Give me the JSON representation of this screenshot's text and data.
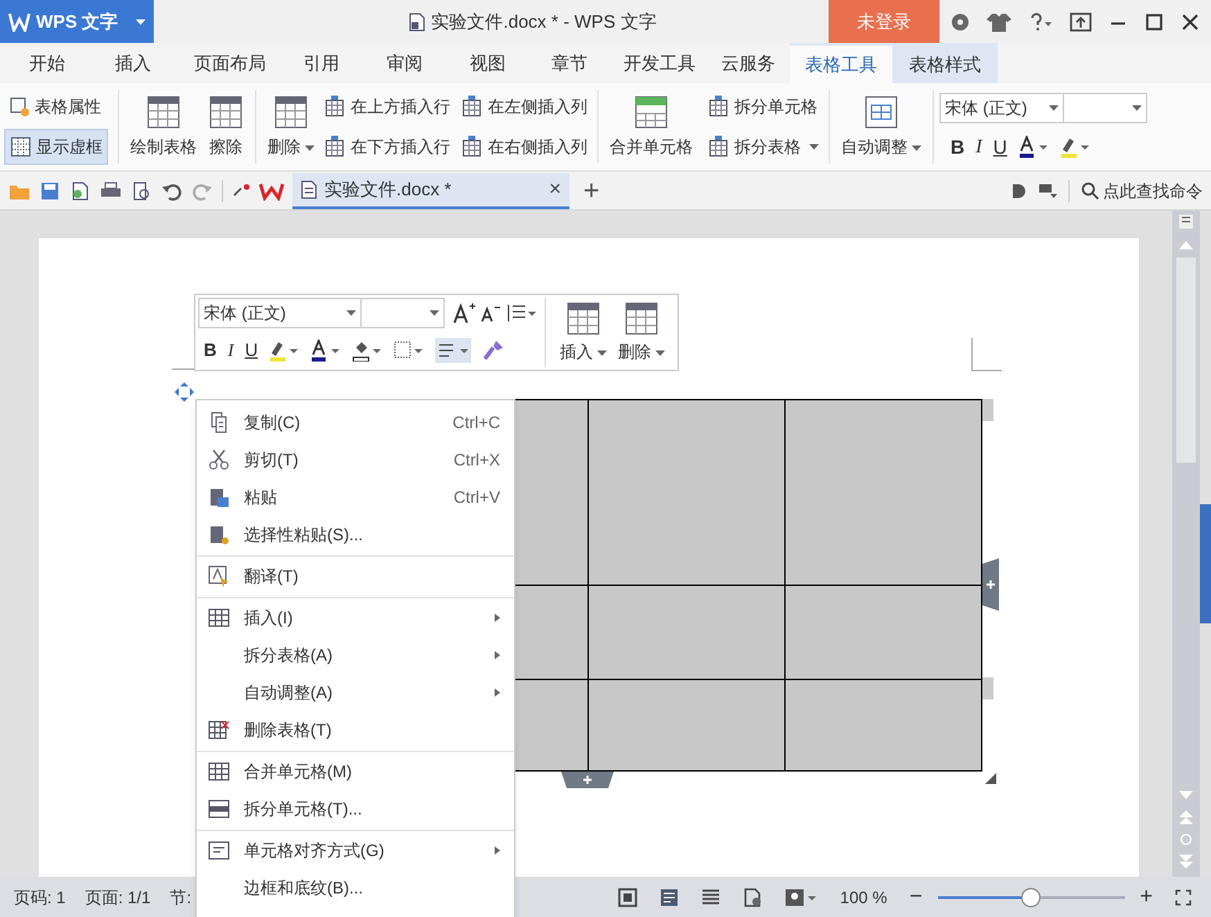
{
  "title_bar": {
    "app_button": "WPS 文字",
    "title": "实验文件.docx * - WPS 文字",
    "login_button": "未登录"
  },
  "menu_tabs": [
    {
      "label": "开始",
      "selected": false,
      "contextual": false
    },
    {
      "label": "插入",
      "selected": false,
      "contextual": false
    },
    {
      "label": "页面布局",
      "selected": false,
      "contextual": false
    },
    {
      "label": "引用",
      "selected": false,
      "contextual": false
    },
    {
      "label": "审阅",
      "selected": false,
      "contextual": false
    },
    {
      "label": "视图",
      "selected": false,
      "contextual": false
    },
    {
      "label": "章节",
      "selected": false,
      "contextual": false
    },
    {
      "label": "开发工具",
      "selected": false,
      "contextual": false
    },
    {
      "label": "云服务",
      "selected": false,
      "contextual": false
    },
    {
      "label": "表格工具",
      "selected": true,
      "contextual": true
    },
    {
      "label": "表格样式",
      "selected": false,
      "contextual": true
    }
  ],
  "ribbon": {
    "table_properties": "表格属性",
    "show_gridlines": {
      "label": "显示虚框",
      "selected": true
    },
    "draw_table": "绘制表格",
    "erase": "擦除",
    "delete": "删除",
    "insert_row_above": "在上方插入行",
    "insert_col_left": "在左侧插入列",
    "insert_row_below": "在下方插入行",
    "insert_col_right": "在右侧插入列",
    "merge_cells": "合并单元格",
    "split_cells": "拆分单元格",
    "split_table": "拆分表格",
    "autofit": "自动调整",
    "font": "宋体 (正文)",
    "bold": "B",
    "italic": "I",
    "underline": "U"
  },
  "quick_toolbar": {
    "document_tab": "实验文件.docx *",
    "tab_close": "×",
    "new_tab": "+",
    "search": "点此查找命令"
  },
  "mini_toolbar": {
    "font": "宋体 (正文)",
    "bold": "B",
    "italic": "I",
    "underline": "U",
    "insert": "插入",
    "delete": "删除"
  },
  "context_menu": [
    {
      "label": "复制(C)",
      "shortcut": "Ctrl+C",
      "kind": "copy",
      "submenu": false,
      "separator_before": false
    },
    {
      "label": "剪切(T)",
      "shortcut": "Ctrl+X",
      "kind": "cut",
      "submenu": false,
      "separator_before": false
    },
    {
      "label": "粘贴",
      "shortcut": "Ctrl+V",
      "kind": "paste",
      "submenu": false,
      "separator_before": false
    },
    {
      "label": "选择性粘贴(S)...",
      "kind": "pastespecial",
      "submenu": false,
      "separator_before": false
    },
    {
      "label": "翻译(T)",
      "kind": "translate",
      "submenu": false,
      "separator_before": true
    },
    {
      "label": "插入(I)",
      "kind": "table",
      "submenu": true,
      "separator_before": true
    },
    {
      "label": "拆分表格(A)",
      "kind": "plain",
      "submenu": true,
      "separator_before": false
    },
    {
      "label": "自动调整(A)",
      "kind": "plain",
      "submenu": true,
      "separator_before": false
    },
    {
      "label": "删除表格(T)",
      "kind": "deletetable",
      "submenu": false,
      "separator_before": false
    },
    {
      "label": "合并单元格(M)",
      "kind": "table",
      "submenu": false,
      "separator_before": true
    },
    {
      "label": "拆分单元格(T)...",
      "kind": "split",
      "submenu": false,
      "separator_before": false
    },
    {
      "label": "单元格对齐方式(G)",
      "kind": "align",
      "submenu": true,
      "separator_before": true
    },
    {
      "label": "边框和底纹(B)...",
      "kind": "plain",
      "submenu": false,
      "separator_before": false
    }
  ],
  "status_bar": {
    "page_number": "页码: 1",
    "pages": "页面: 1/1",
    "section": "节:",
    "zoom": "100 %",
    "zoom_minus": "−",
    "zoom_plus": "+",
    "zoom_slider": {
      "level": 0.5
    }
  }
}
